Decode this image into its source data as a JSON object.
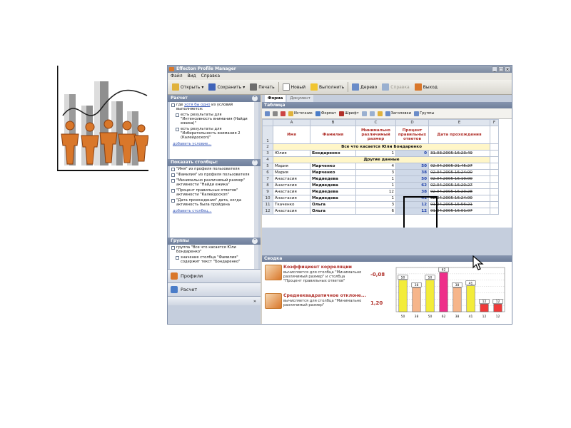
{
  "window": {
    "title": "Effecton Profile Manager",
    "controls": [
      "_",
      "□",
      "×"
    ]
  },
  "menu": [
    "Файл",
    "Вид",
    "Справка"
  ],
  "toolbar": [
    {
      "label": "Открыть",
      "icon": "folder-open-icon",
      "color": "#e0b23c"
    },
    {
      "label": "Сохранить",
      "icon": "save-icon",
      "color": "#3f63b8"
    },
    {
      "label": "Печать",
      "icon": "printer-icon",
      "color": "#6d6d6d"
    },
    {
      "label": "Новый",
      "icon": "new-document-icon",
      "color": "#ffffff"
    },
    {
      "label": "Выполнить",
      "icon": "run-lightning-icon",
      "color": "#f1c531"
    },
    {
      "label": "Дерево",
      "icon": "tree-icon",
      "color": "#6a8cc8"
    },
    {
      "label": "Справка",
      "icon": "help-icon",
      "color": "#9ab0d0",
      "disabled": true
    },
    {
      "label": "Выход",
      "icon": "exit-icon",
      "color": "#d9772a"
    }
  ],
  "left": {
    "calc_header": "Расчет",
    "conditions": {
      "intro_prefix": "где",
      "intro_link": "хотя бы одно",
      "intro_suffix": "из условий выполняется:",
      "items": [
        "есть результаты для \"Интенсивность внимания (Найди ежика)\"",
        "есть результаты для \"Избирательность внимания 2 (Калейдоскоп)\""
      ],
      "add_link": "добавить условие..."
    },
    "columns_header": "Показать столбцы:",
    "columns": [
      "\"Имя\" из профиля пользователя",
      "\"Фамилия\" из профиля пользователя",
      "\"Минимально различимый размер\" активности \"Найди ежика\"",
      "\"Процент правильных ответов\" активности \"Калейдоскоп\"",
      "\"Дата прохождения\" дата, когда активность была пройдена"
    ],
    "columns_add_link": "добавить столбец...",
    "groups_header": "Группы",
    "groups": [
      "группа \"Все что касается Юли Бондаренко\"",
      "значение столбца \"Фамилия\" содержит текст \"Бондаренко\""
    ],
    "nav": [
      {
        "label": "Профили",
        "icon": "profiles-icon",
        "color": "#d9772a"
      },
      {
        "label": "Расчет",
        "icon": "calc-icon",
        "color": "#4a7cc8"
      }
    ]
  },
  "main": {
    "tabs": [
      "Форма",
      "Документ"
    ],
    "table_header": "Таблица",
    "table_tools": [
      "Источник",
      "Формат",
      "Шрифт",
      "Заголовки",
      "Группы"
    ],
    "columns": [
      "A",
      "B",
      "C",
      "D",
      "E",
      "F"
    ],
    "headers": [
      "Имя",
      "Фамилия",
      "Минимально различимый размер",
      "Процент правильных ответов",
      "Дата прохождения"
    ],
    "group1": "Все что касается Юли Бондаренко",
    "group2": "Другие данные",
    "rows": [
      {
        "n": "3",
        "first": "Юлия",
        "last": "Бондаренко",
        "size": "1",
        "pct": "0",
        "date": "31.03.2005 16:23:49"
      },
      {
        "n": "5",
        "first": "Мария",
        "last": "Марченко",
        "size": "4",
        "pct": "50",
        "date": "02.04.2005 21:45:27"
      },
      {
        "n": "6",
        "first": "Мария",
        "last": "Марченко",
        "size": "3",
        "pct": "38",
        "date": "02.04.2005 16:24:00"
      },
      {
        "n": "7",
        "first": "Анастасия",
        "last": "Медведева",
        "size": "1",
        "pct": "50",
        "date": "02.04.2005 16:19:00"
      },
      {
        "n": "8",
        "first": "Анастасия",
        "last": "Медведева",
        "size": "1",
        "pct": "62",
        "date": "02.04.2005 16:20:27"
      },
      {
        "n": "9",
        "first": "Анастасия",
        "last": "Медведева",
        "size": "12",
        "pct": "38",
        "date": "02.04.2005 16:23:28"
      },
      {
        "n": "10",
        "first": "Анастасия",
        "last": "Медведева",
        "size": "1",
        "pct": "41",
        "date": "02.04.2005 16:24:00"
      },
      {
        "n": "11",
        "first": "Ткаченко",
        "last": "Ольга",
        "size": "3",
        "pct": "12",
        "date": "01.04.2005 15:56:21"
      },
      {
        "n": "12",
        "first": "Анастасия",
        "last": "Ольга",
        "size": "6",
        "pct": "12",
        "date": "01.04.2005 16:01:07"
      }
    ]
  },
  "summary": {
    "header": "Сводка",
    "metrics": [
      {
        "title": "Коэффициент корреляции",
        "desc": "вычисляется для столбца \"Минимально различимый размер\" и столбца \"Процент правильных ответов\"",
        "value": "-0,08"
      },
      {
        "title": "Среднеквадратичное отклоне...",
        "desc": "вычисляется для столбца \"Минимально различимый размер\"",
        "value": "1,20"
      }
    ]
  },
  "chart_data": {
    "type": "bar",
    "categories": [
      "50",
      "38",
      "50",
      "62",
      "38",
      "41",
      "12",
      "12"
    ],
    "values": [
      50,
      38,
      50,
      62,
      38,
      41,
      12,
      12
    ],
    "labels": [
      "50",
      "38",
      "50",
      "62",
      "38",
      "41",
      "12",
      "12"
    ],
    "colors": [
      "#f3ec3a",
      "#f6b58a",
      "#f3ec3a",
      "#ee2f8a",
      "#f6b58a",
      "#f3ec3a",
      "#f03a3a",
      "#f03a3a"
    ],
    "ylim": [
      0,
      70
    ],
    "grid": true
  }
}
